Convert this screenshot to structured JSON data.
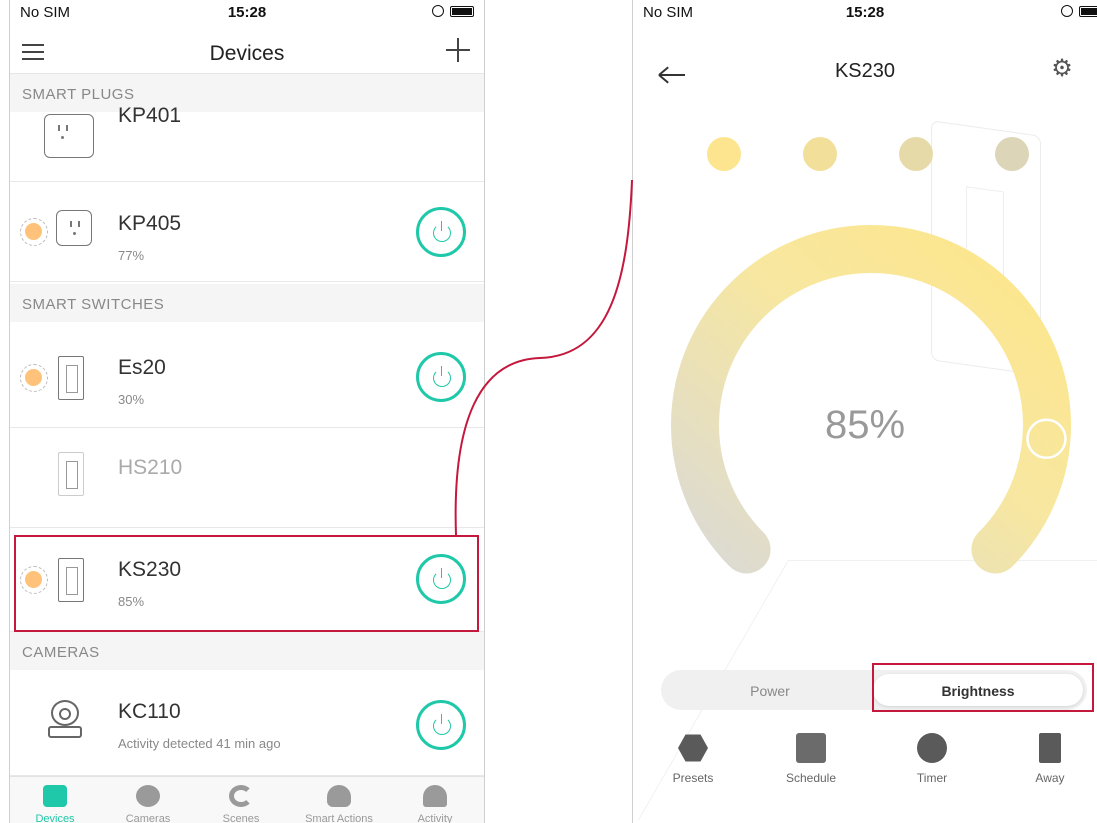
{
  "status": {
    "carrier": "No SIM",
    "time": "15:28"
  },
  "devices_screen": {
    "title": "Devices",
    "sections": {
      "plugs": "SMART PLUGS",
      "switches": "SMART SWITCHES",
      "cameras": "CAMERAS"
    },
    "rows": {
      "kp401": {
        "name": "KP401"
      },
      "kp405": {
        "name": "KP405",
        "sub": "77%"
      },
      "es20": {
        "name": "Es20",
        "sub": "30%"
      },
      "hs210": {
        "name": "HS210"
      },
      "ks230": {
        "name": "KS230",
        "sub": "85%"
      },
      "kc110": {
        "name": "KC110",
        "sub": "Activity detected 41 min ago"
      }
    },
    "tabs": [
      "Devices",
      "Cameras",
      "Scenes",
      "Smart Actions",
      "Activity"
    ]
  },
  "ks230_screen": {
    "title": "KS230",
    "brightness": "85%",
    "brightness_value": 85,
    "preset_colors": [
      "#fde58f",
      "#f2e09a",
      "#e6dba8",
      "#dcd5b8"
    ],
    "segments": {
      "power": "Power",
      "brightness": "Brightness"
    },
    "actions": [
      "Presets",
      "Schedule",
      "Timer",
      "Away"
    ]
  },
  "colors": {
    "accent": "#1fc8a8",
    "highlight": "#c4183c",
    "ring_start": "#dcdad3",
    "ring_end": "#fde68a"
  }
}
